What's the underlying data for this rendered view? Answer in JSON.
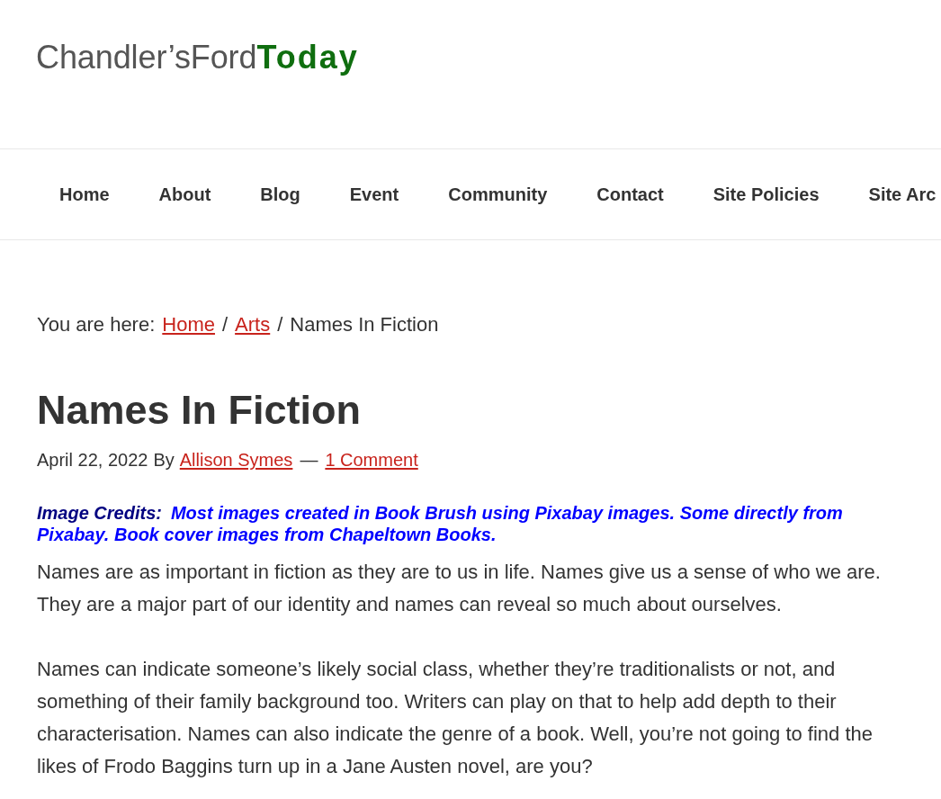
{
  "site_logo": "Chandler’sFord**Today**",
  "nav": [
    "Home",
    "About",
    "Blog",
    "Event",
    "Community",
    "Contact",
    "Site Policies",
    "Site Arc"
  ],
  "breadcrumb": {
    "label": "You are here:",
    "items": [
      {
        "text": "Home",
        "kind": "link"
      },
      {
        "separator": "/",
        "text": "Arts",
        "kind": "link"
      },
      {
        "separator": "/",
        "text": "Names In Fiction",
        "kind": "current"
      }
    ]
  },
  "article": {
    "title": "Names In Fiction",
    "meta": {
      "date": "April 22, 2022",
      "by": "By",
      "author": "Allison Symes",
      "separator": "—",
      "comments": "1 Comment"
    },
    "image_credits": {
      "label": "Image Credits:",
      "text": "Most images created in Book Brush using Pixabay images. Some directly from Pixabay. Book cover images from Chapeltown Books."
    },
    "paragraphs": [
      "Names are as important in fiction as they are to us in life. Names give us a sense of who we are. They are a major part of our identity and names can reveal so much about ourselves.",
      "Names can indicate someone’s likely social class, whether they’re traditionalists or not, and something of their family background too. Writers can play on that to help add depth to their characterisation. Names can also indicate the genre of a book. Well, you’re not going to find the likes of Frodo Baggins turn up in a Jane Austen novel, are you?"
    ]
  }
}
